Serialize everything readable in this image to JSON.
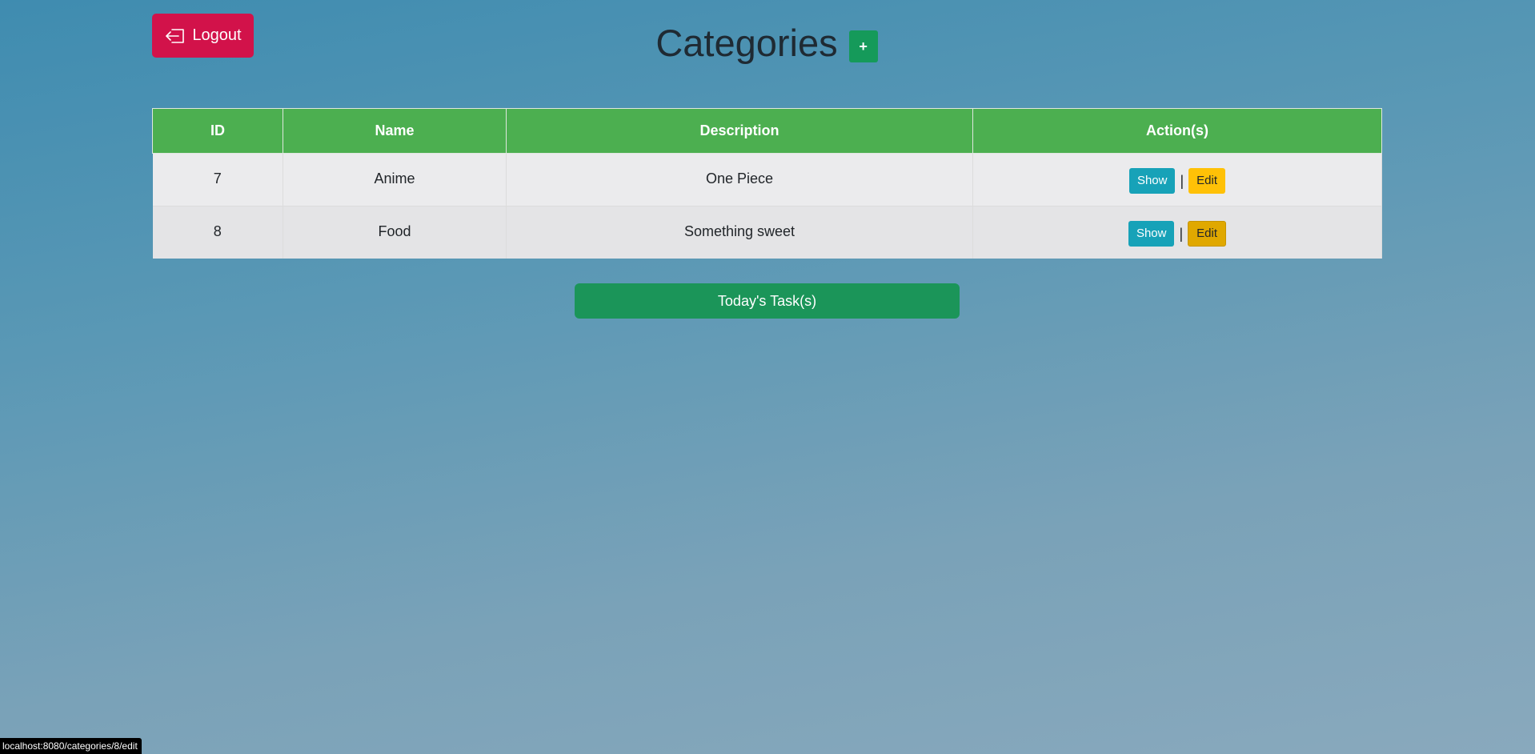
{
  "header": {
    "logout_label": "Logout",
    "title": "Categories",
    "add_label": "+"
  },
  "table": {
    "columns": [
      "ID",
      "Name",
      "Description",
      "Action(s)"
    ],
    "rows": [
      {
        "id": "7",
        "name": "Anime",
        "description": "One Piece",
        "show_label": "Show",
        "separator": "|",
        "edit_label": "Edit"
      },
      {
        "id": "8",
        "name": "Food",
        "description": "Something sweet",
        "show_label": "Show",
        "separator": "|",
        "edit_label": "Edit"
      }
    ]
  },
  "footer": {
    "today_label": "Today's Task(s)"
  },
  "status_bar": {
    "url": "localhost:8080/categories/8/edit"
  },
  "colors": {
    "logout": "#d2124a",
    "header_green": "#4caf50",
    "add_green": "#159a5a",
    "today_green": "#1b9559",
    "show_info": "#17a2b8",
    "edit_warning": "#ffc107"
  },
  "icons": {
    "logout": "box-arrow-left-icon"
  }
}
